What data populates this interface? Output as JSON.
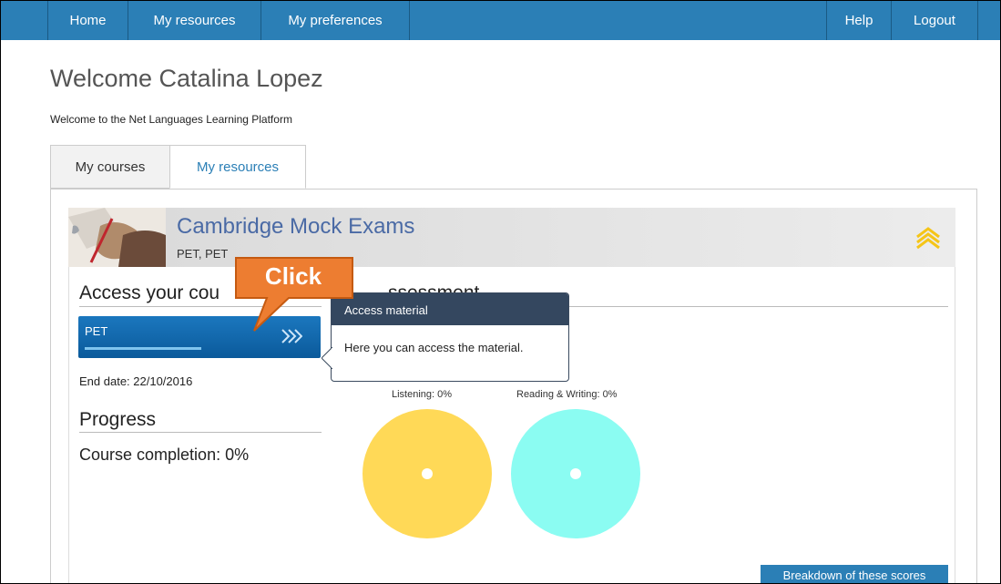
{
  "nav": {
    "home": "Home",
    "my_resources": "My resources",
    "my_preferences": "My preferences",
    "help": "Help",
    "logout": "Logout"
  },
  "page": {
    "title": "Welcome Catalina Lopez",
    "subtitle": "Welcome to the Net Languages Learning Platform"
  },
  "tabs": [
    {
      "label": "My courses",
      "active": true
    },
    {
      "label": "My resources",
      "active": false
    }
  ],
  "course": {
    "title": "Cambridge Mock Exams",
    "subtitle": "PET, PET",
    "access_heading": "Access your cou",
    "assessment_heading": "ssessment",
    "button_label": "PET",
    "end_date": "End date: 22/10/2016",
    "progress_heading": "Progress",
    "completion": "Course completion: 0%"
  },
  "scores": [
    {
      "label": "Listening: 0%",
      "value": 0,
      "color": "#ffd957"
    },
    {
      "label": "Reading & Writing: 0%",
      "value": 0,
      "color": "#8bfcf2"
    }
  ],
  "breakdown_button": "Breakdown of these scores",
  "tooltip": {
    "title": "Access material",
    "body": "Here you can access the material."
  },
  "callout": {
    "text": "Click",
    "color": "#ed7d31"
  },
  "colors": {
    "nav_bg": "#2b7fb6",
    "course_button": "#0b6aad",
    "title_text": "#4a6aa5",
    "accent_chevron": "#f5c518"
  }
}
